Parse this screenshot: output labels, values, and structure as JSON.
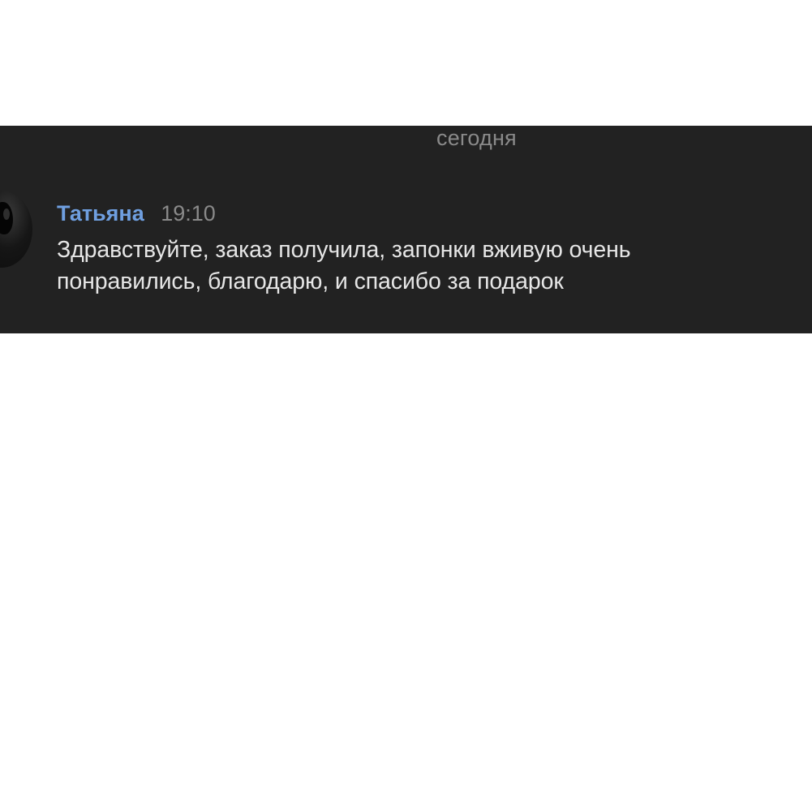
{
  "chat": {
    "date_divider": "сегодня",
    "message": {
      "author": "Татьяна",
      "time": "19:10",
      "text_line1": "Здравствуйте, заказ получила, запонки вживую очень",
      "text_line2": "понравились, благодарю, и спасибо за подарок",
      "avatar_icon": "user-avatar-photo"
    }
  },
  "colors": {
    "panel_background": "#222222",
    "author_name": "#6f9fe0",
    "muted_text": "#8a8a8a",
    "message_text": "#e6e6e6",
    "page_background": "#ffffff"
  }
}
